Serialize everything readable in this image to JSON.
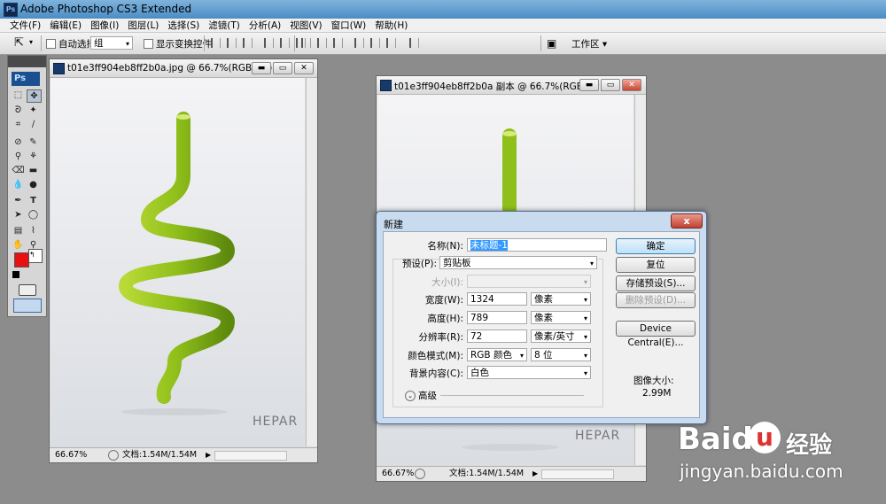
{
  "app": {
    "title": "Adobe Photoshop CS3 Extended",
    "logo": "Ps"
  },
  "menu": [
    "文件(F)",
    "编辑(E)",
    "图像(I)",
    "图层(L)",
    "选择(S)",
    "滤镜(T)",
    "分析(A)",
    "视图(V)",
    "窗口(W)",
    "帮助(H)"
  ],
  "options": {
    "auto_select": "自动选择:",
    "auto_select_value": "组",
    "show_transform": "显示变换控件",
    "workspace": "工作区"
  },
  "doc1": {
    "title": "t01e3ff904eb8ff2b0a.jpg @ 66.7%(RGB/8#)",
    "zoom": "66.67%",
    "doc_size": "文档:1.54M/1.54M",
    "brand": "HEPAR"
  },
  "doc2": {
    "title": "t01e3ff904eb8ff2b0a 副本 @ 66.7%(RGB/8#)",
    "zoom": "66.67%",
    "doc_size": "文档:1.54M/1.54M",
    "brand": "HEPAR"
  },
  "dialog": {
    "title": "新建",
    "close": "x",
    "name_label": "名称(N):",
    "name_value": "未标题-1",
    "preset_label": "预设(P):",
    "preset_value": "剪贴板",
    "size_label": "大小(I):",
    "width_label": "宽度(W):",
    "width_value": "1324",
    "width_unit": "像素",
    "height_label": "高度(H):",
    "height_value": "789",
    "height_unit": "像素",
    "resolution_label": "分辨率(R):",
    "resolution_value": "72",
    "resolution_unit": "像素/英寸",
    "color_mode_label": "颜色模式(M):",
    "color_mode_value": "RGB 颜色",
    "bit_depth": "8 位",
    "bg_label": "背景内容(C):",
    "bg_value": "白色",
    "advanced": "高级",
    "ok": "确定",
    "reset": "复位",
    "save_preset": "存储预设(S)...",
    "delete_preset": "删除预设(D)...",
    "device_central": "Device Central(E)...",
    "image_size_label": "图像大小:",
    "image_size_value": "2.99M"
  },
  "watermark": {
    "brand": "Baid",
    "brand2": "u",
    "cn": "经验",
    "url": "jingyan.baidu.com"
  },
  "colors": {
    "foreground": "#e81010",
    "background": "#ffffff",
    "asparagus": "#8fbf1a"
  }
}
